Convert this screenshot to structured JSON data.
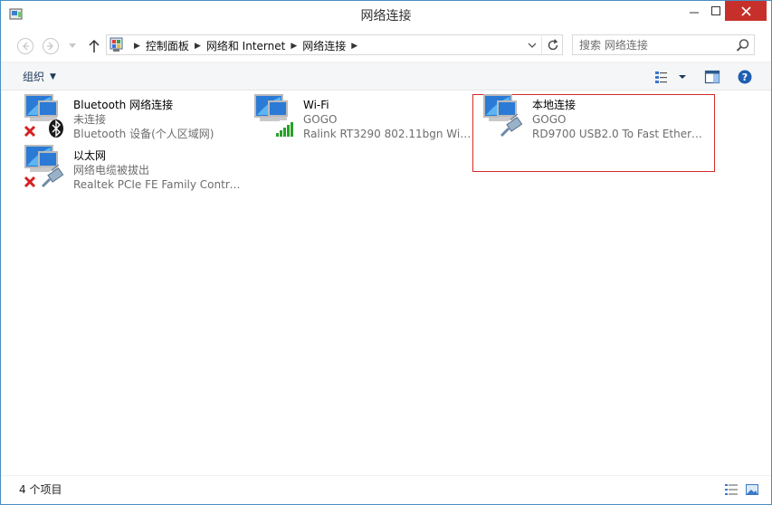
{
  "window": {
    "title": "网络连接",
    "controls": {
      "minimize": "—",
      "maximize": "☐",
      "close": "✕"
    }
  },
  "navigation": {
    "back_icon": "back-arrow-icon",
    "forward_icon": "forward-arrow-icon",
    "up_icon": "up-arrow-icon"
  },
  "address": {
    "breadcrumbs": [
      "控制面板",
      "网络和 Internet",
      "网络连接"
    ]
  },
  "search": {
    "placeholder": "搜索 网络连接"
  },
  "command_bar": {
    "organize_label": "组织"
  },
  "connections": [
    {
      "name": "Bluetooth 网络连接",
      "status": "未连接",
      "device": "Bluetooth 设备(个人区域网)"
    },
    {
      "name": "Wi-Fi",
      "status": "GOGO",
      "device": "Ralink RT3290 802.11bgn Wi-Fi..."
    },
    {
      "name": "本地连接",
      "status": "GOGO",
      "device": "RD9700 USB2.0 To Fast Ethern..."
    },
    {
      "name": "以太网",
      "status": "网络电缆被拔出",
      "device": "Realtek PCIe FE Family Control..."
    }
  ],
  "status_bar": {
    "item_count": "4 个项目"
  },
  "colors": {
    "close_button": "#c7302a",
    "selection_border": "#d32a2a",
    "secondary_text": "#6d6d6d",
    "window_border": "#4a8fc2"
  }
}
